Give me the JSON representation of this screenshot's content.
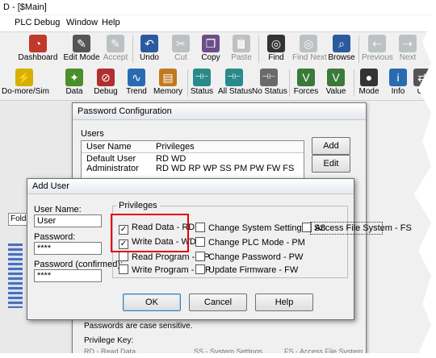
{
  "window": {
    "title": "D - [$Main]"
  },
  "menu": [
    "PLC",
    "Debug",
    "Window",
    "Help"
  ],
  "toolbar1": [
    {
      "label": "Dashboard",
      "icon": "dashboard-icon",
      "glyph": "◔",
      "color": "#c0392b",
      "enabled": true
    },
    {
      "label": "Edit Mode",
      "icon": "edit-mode-icon",
      "glyph": "✎",
      "color": "#555555",
      "enabled": true
    },
    {
      "label": "Accept",
      "icon": "accept-icon",
      "glyph": "✎",
      "color": "#7f8c8d",
      "enabled": false
    },
    {
      "label": "Undo",
      "icon": "undo-icon",
      "glyph": "↶",
      "color": "#2c5aa0",
      "enabled": true
    },
    {
      "label": "Cut",
      "icon": "cut-icon",
      "glyph": "✂",
      "color": "#7f8c8d",
      "enabled": false
    },
    {
      "label": "Copy",
      "icon": "copy-icon",
      "glyph": "❐",
      "color": "#6c4f8a",
      "enabled": true
    },
    {
      "label": "Paste",
      "icon": "paste-icon",
      "glyph": "📋",
      "color": "#7f8c8d",
      "enabled": false
    },
    {
      "label": "Find",
      "icon": "binoculars-icon",
      "glyph": "◎",
      "color": "#333333",
      "enabled": true
    },
    {
      "label": "Find Next",
      "icon": "find-next-icon",
      "glyph": "◎",
      "color": "#7f8c8d",
      "enabled": false
    },
    {
      "label": "Browse",
      "icon": "browse-icon",
      "glyph": "⌕",
      "color": "#2c5aa0",
      "enabled": true
    },
    {
      "label": "Previous",
      "icon": "previous-icon",
      "glyph": "⇠",
      "color": "#7f8c8d",
      "enabled": false
    },
    {
      "label": "Next",
      "icon": "next-icon",
      "glyph": "⇢",
      "color": "#7f8c8d",
      "enabled": false
    }
  ],
  "toolbar2": [
    {
      "label": "Do-more/Sim",
      "icon": "simulator-icon",
      "glyph": "⚡",
      "color": "#d4b000"
    },
    {
      "label": "Data",
      "icon": "data-icon",
      "glyph": "✦",
      "color": "#4a8f2a"
    },
    {
      "label": "Debug",
      "icon": "debug-icon",
      "glyph": "⊘",
      "color": "#b03030"
    },
    {
      "label": "Trend",
      "icon": "trend-icon",
      "glyph": "∿",
      "color": "#2a6bb0"
    },
    {
      "label": "Memory",
      "icon": "memory-icon",
      "glyph": "▤",
      "color": "#c07a20"
    },
    {
      "label": "Status",
      "icon": "status-icon",
      "glyph": "⊣⊢",
      "color": "#2a8a8a"
    },
    {
      "label": "All Status",
      "icon": "all-status-icon",
      "glyph": "⊣⊢",
      "color": "#2a8a8a"
    },
    {
      "label": "No Status",
      "icon": "no-status-icon",
      "glyph": "⊣⊢",
      "color": "#6a6a6a"
    },
    {
      "label": "Forces",
      "icon": "forces-icon",
      "glyph": "V",
      "color": "#3a7a3a"
    },
    {
      "label": "Value",
      "icon": "value-icon",
      "glyph": "V",
      "color": "#3a7a3a"
    },
    {
      "label": "Mode",
      "icon": "mode-icon",
      "glyph": "●",
      "color": "#333333"
    },
    {
      "label": "Info",
      "icon": "info-icon",
      "glyph": "i",
      "color": "#2a6bb0"
    },
    {
      "label": "Co",
      "icon": "connect-icon",
      "glyph": "⇄",
      "color": "#555555"
    }
  ],
  "background": {
    "folder_tab": "Folde"
  },
  "password_config": {
    "title": "Password Configuration",
    "users_label": "Users",
    "columns": [
      "User Name",
      "Privileges"
    ],
    "rows": [
      {
        "name": "Default User",
        "privileges": "RD WD"
      },
      {
        "name": "Administrator",
        "privileges": "RD WD RP WP SS PM PW FW FS"
      }
    ],
    "add_label": "Add",
    "edit_label": "Edit",
    "note": "Passwords are case sensitive.",
    "privilege_key_label": "Privilege Key:",
    "key_items": [
      "RD - Read Data",
      "SS - System Settings",
      "FS - Access File System"
    ]
  },
  "add_user": {
    "title": "Add User",
    "username_label": "User Name:",
    "username_value": "User",
    "password_label": "Password:",
    "password_value": "****",
    "password_confirm_label": "Password (confirmed):",
    "password_confirm_value": "****",
    "privileges_title": "Privileges",
    "privileges": [
      {
        "label": "Read Data - RD",
        "checked": true
      },
      {
        "label": "Write Data - WD",
        "checked": true
      },
      {
        "label": "Read Program - RP",
        "checked": false
      },
      {
        "label": "Write Program - WP",
        "checked": false
      },
      {
        "label": "Change System Settings - SS",
        "checked": false
      },
      {
        "label": "Change PLC Mode - PM",
        "checked": false
      },
      {
        "label": "Change Password - PW",
        "checked": false
      },
      {
        "label": "Update Firmware - FW",
        "checked": false
      },
      {
        "label": "Access File System - FS",
        "checked": false
      }
    ],
    "ok_label": "OK",
    "cancel_label": "Cancel",
    "help_label": "Help",
    "highlight_color": "#e3000f"
  }
}
